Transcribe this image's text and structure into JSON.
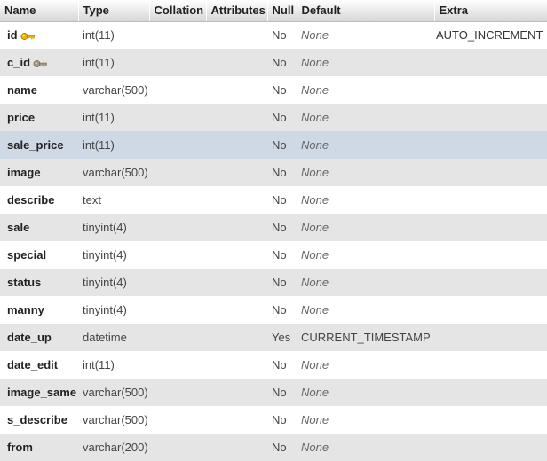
{
  "headers": [
    "Name",
    "Type",
    "Collation",
    "Attributes",
    "Null",
    "Default",
    "Extra"
  ],
  "rows": [
    {
      "name": "id",
      "type": "int(11)",
      "null": "No",
      "default": "None",
      "extra": "AUTO_INCREMENT",
      "icon": "primary-key-icon"
    },
    {
      "name": "c_id",
      "type": "int(11)",
      "null": "No",
      "default": "None",
      "extra": "",
      "icon": "index-key-icon"
    },
    {
      "name": "name",
      "type": "varchar(500)",
      "null": "No",
      "default": "None",
      "extra": ""
    },
    {
      "name": "price",
      "type": "int(11)",
      "null": "No",
      "default": "None",
      "extra": ""
    },
    {
      "name": "sale_price",
      "type": "int(11)",
      "null": "No",
      "default": "None",
      "extra": "",
      "highlight": true
    },
    {
      "name": "image",
      "type": "varchar(500)",
      "null": "No",
      "default": "None",
      "extra": ""
    },
    {
      "name": "describe",
      "type": "text",
      "null": "No",
      "default": "None",
      "extra": ""
    },
    {
      "name": "sale",
      "type": "tinyint(4)",
      "null": "No",
      "default": "None",
      "extra": ""
    },
    {
      "name": "special",
      "type": "tinyint(4)",
      "null": "No",
      "default": "None",
      "extra": ""
    },
    {
      "name": "status",
      "type": "tinyint(4)",
      "null": "No",
      "default": "None",
      "extra": ""
    },
    {
      "name": "manny",
      "type": "tinyint(4)",
      "null": "No",
      "default": "None",
      "extra": ""
    },
    {
      "name": "date_up",
      "type": "datetime",
      "null": "Yes",
      "default": "CURRENT_TIMESTAMP",
      "extra": ""
    },
    {
      "name": "date_edit",
      "type": "int(11)",
      "null": "No",
      "default": "None",
      "extra": ""
    },
    {
      "name": "image_same",
      "type": "varchar(500)",
      "null": "No",
      "default": "None",
      "extra": ""
    },
    {
      "name": "s_describe",
      "type": "varchar(500)",
      "null": "No",
      "default": "None",
      "extra": ""
    },
    {
      "name": "from",
      "type": "varchar(200)",
      "null": "No",
      "default": "None",
      "extra": ""
    }
  ],
  "colors": {
    "primary_key": "#e8b400",
    "index_key": "#9a9a9a",
    "row_alt": "#e5e5e5",
    "row_highlight": "#cfd8e5"
  }
}
